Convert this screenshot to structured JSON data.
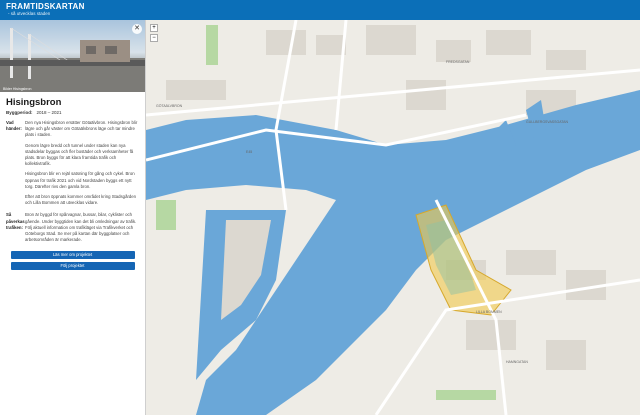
{
  "header": {
    "brand": "FRAMTIDSKARTAN",
    "sub": "- så utvecklas staden"
  },
  "photo": {
    "caption": "Bilder Hisingsbron"
  },
  "info": {
    "title": "Hisingsbron",
    "byggperiod_label": "Byggperiod:",
    "byggperiod_value": "2018 – 2021",
    "vad_label": "Vad händer:",
    "vad_paragraphs": [
      "Den nya Hisingsbron ersätter Götaälvbron. Hisingsbron blir lägre och går väster om Götaälvbrons läge och tar mindre plats i staden.",
      "Genom lägre bredd och tunnel under staden kan nya stadsdelar byggas och fler bostäder och verksamheter få plats. Bron byggs för att klara framtida trafik och kollektivtrafik.",
      "Hisingsbron blir en rejäl satsning för gång och cykel. Bron öppnas för trafik 2021 och vid Nordstaden byggs ett nytt torg. Därefter rivs den gamla bron.",
      "Efter att bron öppnats kommer området kring Stadsgården och Lilla Bommen att utvecklas vidare."
    ],
    "hur_label": "Så påverkas trafiken:",
    "hur_text": "Bron är byggd för spårvagnar, bussar, bilar, cyklister och gående. Under byggtiden kan det bli omledningar av trafik. Följ aktuell information om trafikläget via Trafikverket och Göteborgs Stad. Se mer på kartan där byggplatser och arbetsområden är markerade.",
    "btn1": "Läs mer om projektet",
    "btn2": "Följ projektet"
  },
  "map": {
    "zoom_in": "+",
    "zoom_out": "−",
    "streets": [
      "GÖTAÄLVBRON",
      "FREDSGATAN",
      "GULLBERGSVASSGATAN",
      "LILLA BOMMEN",
      "HAMNGATAN",
      "E45"
    ],
    "colors": {
      "water": "#6aa7d8",
      "land": "#eeece6",
      "block": "#dcd8d0",
      "green": "#b6d8a3",
      "highlight": "#f2c94c"
    }
  }
}
